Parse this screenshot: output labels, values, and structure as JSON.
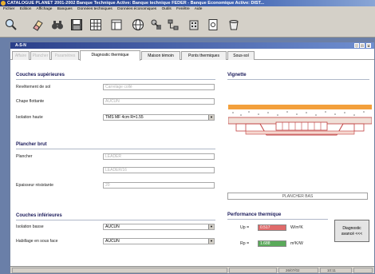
{
  "app": {
    "title": "CATALOGUE PLANET 2001-2002  Banque Technique Active: Banque technique FEDER  -  Banque Economique Active: DIST...",
    "menu": [
      "Fichier",
      "Edition",
      "Affichage",
      "Banques",
      "Données techniques",
      "Données économiques",
      "Outils",
      "Fenêtre",
      "Aide"
    ]
  },
  "toolbar": {
    "icons": [
      "zoom-icon",
      "eraser-icon",
      "binoculars-icon",
      "save-icon",
      "grid-icon",
      "table-icon",
      "globe-icon",
      "tools-icon",
      "network-icon",
      "building-icon",
      "document-icon",
      "bucket-icon"
    ]
  },
  "window": {
    "title": "A-S-N",
    "tabs": [
      {
        "label": "Affaire",
        "state": "disabled"
      },
      {
        "label": "Plancher",
        "state": "disabled"
      },
      {
        "label": "Paramètres",
        "state": "disabled"
      },
      {
        "label": "Diagnostic thermique",
        "state": "active"
      },
      {
        "label": "Maison témoin",
        "state": "enabled"
      },
      {
        "label": "Ponts thermiques",
        "state": "enabled"
      },
      {
        "label": "Sous-sol",
        "state": "enabled"
      }
    ]
  },
  "couches_sup": {
    "title": "Couches supérieures",
    "revetement_label": "Revêtement de sol",
    "revetement_value": "Carrelage collé",
    "chape_label": "Chape flottante",
    "chape_value": "AUCUN",
    "isolation_label": "Isolation haute",
    "isolation_value": "TMS MF  4cm  R=1.55"
  },
  "plancher_brut": {
    "title": "Plancher brut",
    "plancher_label": "Plancher",
    "plancher_value": "LEADER",
    "plancher_value2": "LEADER/16",
    "epaisseur_label": "Epaisseur résistante",
    "epaisseur_value": "20"
  },
  "couches_inf": {
    "title": "Couches inférieures",
    "isolation_label": "Isolation basse",
    "isolation_value": "AUCUN",
    "habillage_label": "Habillage en sous face",
    "habillage_value": "AUCUN"
  },
  "vignette": {
    "title": "Vignette",
    "caption": "PLANCHER BAS"
  },
  "performance": {
    "title": "Performance thermique",
    "up_label": "Up =",
    "up_value": "0.517",
    "up_unit": "W/m²K",
    "up_color": "#e06a6a",
    "rp_label": "Rp =",
    "rp_value": "1.688",
    "rp_unit": "m²K/W",
    "rp_color": "#5aaa5a",
    "diag_button_line1": "Diagnostic",
    "diag_button_line2": "avancé <<<"
  },
  "status": {
    "date": "26/07/02",
    "time": "10:11"
  }
}
